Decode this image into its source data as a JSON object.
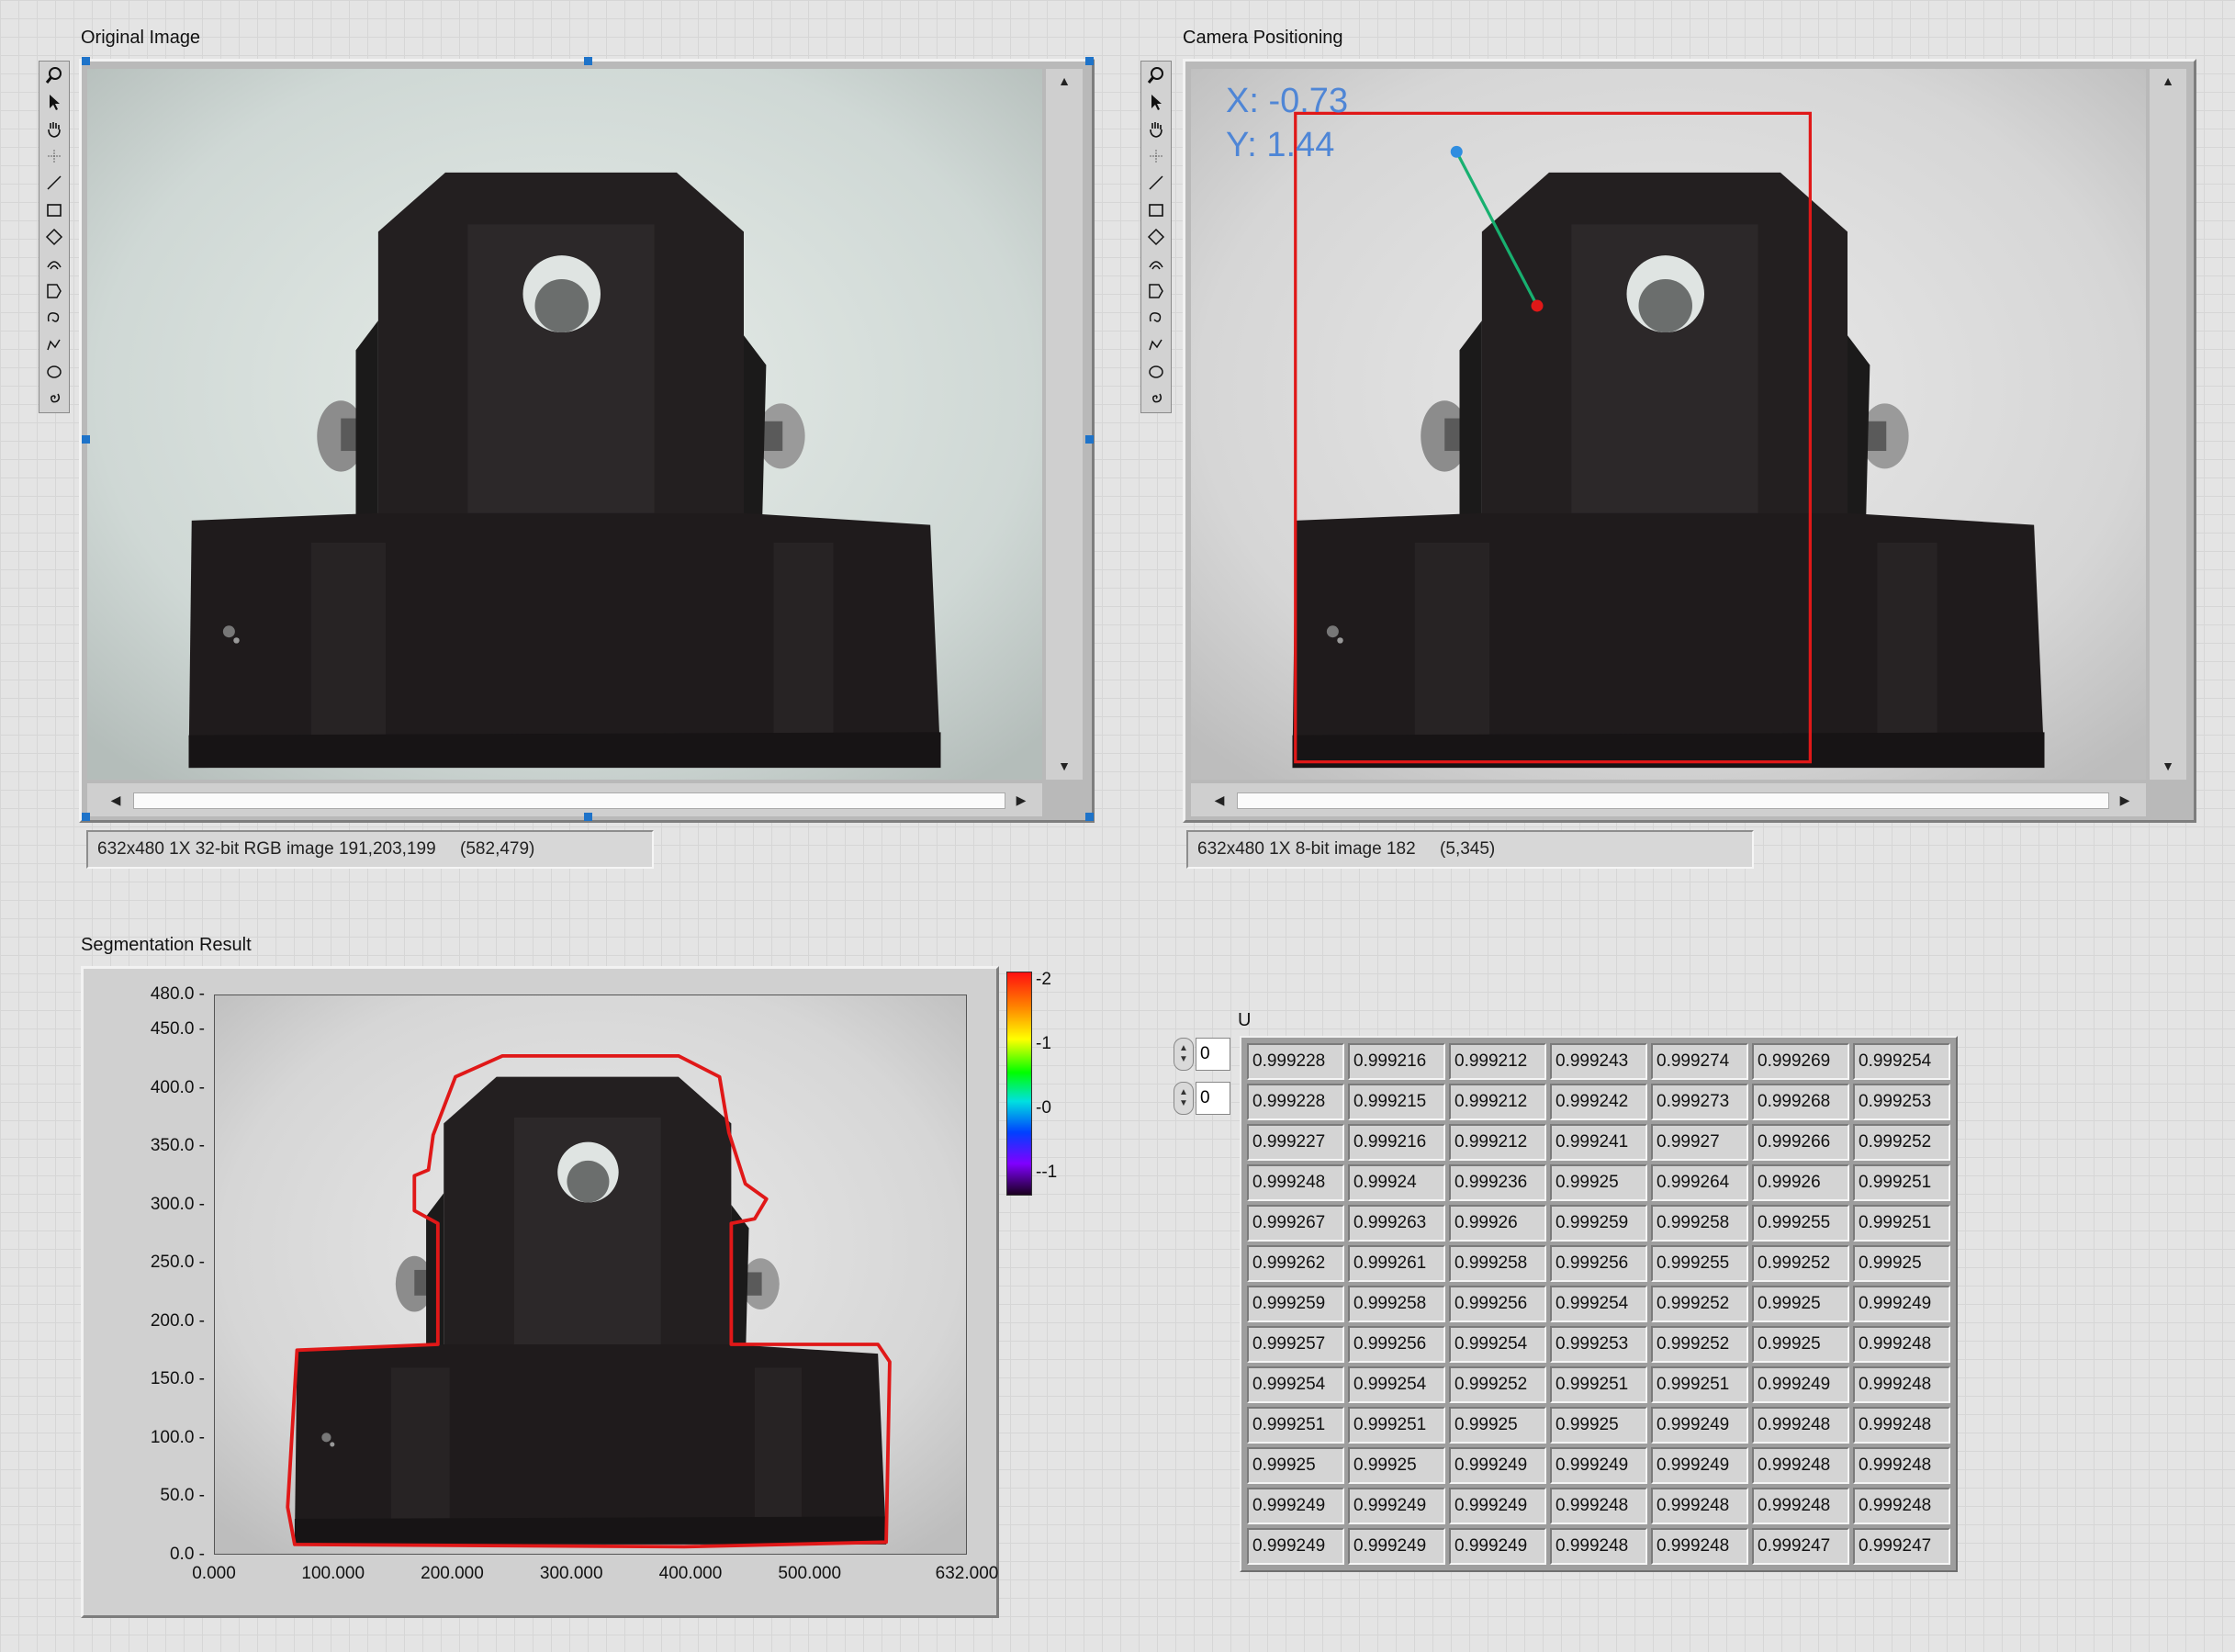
{
  "original": {
    "label": "Original Image",
    "status_text": "632x480 1X 32-bit RGB image 191,203,199     (582,479)"
  },
  "camera": {
    "label": "Camera Positioning",
    "x_readout": "X: -0.73",
    "y_readout": "Y: 1.44",
    "status_text": "632x480 1X 8-bit image 182     (5,345)"
  },
  "segmentation": {
    "label": "Segmentation Result",
    "y_ticks": [
      "480.0",
      "450.0",
      "400.0",
      "350.0",
      "300.0",
      "250.0",
      "200.0",
      "150.0",
      "100.0",
      "50.0",
      "0.0"
    ],
    "x_ticks": [
      "0.000",
      "100.000",
      "200.000",
      "300.000",
      "400.000",
      "500.000",
      "632.000"
    ],
    "colorscale_ticks": [
      "2",
      "1",
      "0",
      "-1"
    ],
    "contour_color": "#e01818"
  },
  "array": {
    "label": "U",
    "row_index": "0",
    "col_index": "0",
    "rows": [
      [
        "0.999228",
        "0.999216",
        "0.999212",
        "0.999243",
        "0.999274",
        "0.999269",
        "0.999254"
      ],
      [
        "0.999228",
        "0.999215",
        "0.999212",
        "0.999242",
        "0.999273",
        "0.999268",
        "0.999253"
      ],
      [
        "0.999227",
        "0.999216",
        "0.999212",
        "0.999241",
        "0.99927",
        "0.999266",
        "0.999252"
      ],
      [
        "0.999248",
        "0.99924",
        "0.999236",
        "0.99925",
        "0.999264",
        "0.99926",
        "0.999251"
      ],
      [
        "0.999267",
        "0.999263",
        "0.99926",
        "0.999259",
        "0.999258",
        "0.999255",
        "0.999251"
      ],
      [
        "0.999262",
        "0.999261",
        "0.999258",
        "0.999256",
        "0.999255",
        "0.999252",
        "0.99925"
      ],
      [
        "0.999259",
        "0.999258",
        "0.999256",
        "0.999254",
        "0.999252",
        "0.99925",
        "0.999249"
      ],
      [
        "0.999257",
        "0.999256",
        "0.999254",
        "0.999253",
        "0.999252",
        "0.99925",
        "0.999248"
      ],
      [
        "0.999254",
        "0.999254",
        "0.999252",
        "0.999251",
        "0.999251",
        "0.999249",
        "0.999248"
      ],
      [
        "0.999251",
        "0.999251",
        "0.99925",
        "0.99925",
        "0.999249",
        "0.999248",
        "0.999248"
      ],
      [
        "0.99925",
        "0.99925",
        "0.999249",
        "0.999249",
        "0.999249",
        "0.999248",
        "0.999248"
      ],
      [
        "0.999249",
        "0.999249",
        "0.999249",
        "0.999248",
        "0.999248",
        "0.999248",
        "0.999248"
      ],
      [
        "0.999249",
        "0.999249",
        "0.999249",
        "0.999248",
        "0.999248",
        "0.999247",
        "0.999247"
      ]
    ]
  },
  "tools": [
    "zoom-icon",
    "pointer-icon",
    "pan-icon",
    "point-icon",
    "line-icon",
    "rectangle-icon",
    "rotated-rectangle-icon",
    "annulus-icon",
    "polygon-icon",
    "freehand-icon",
    "broken-line-icon",
    "oval-icon",
    "spiral-icon"
  ]
}
